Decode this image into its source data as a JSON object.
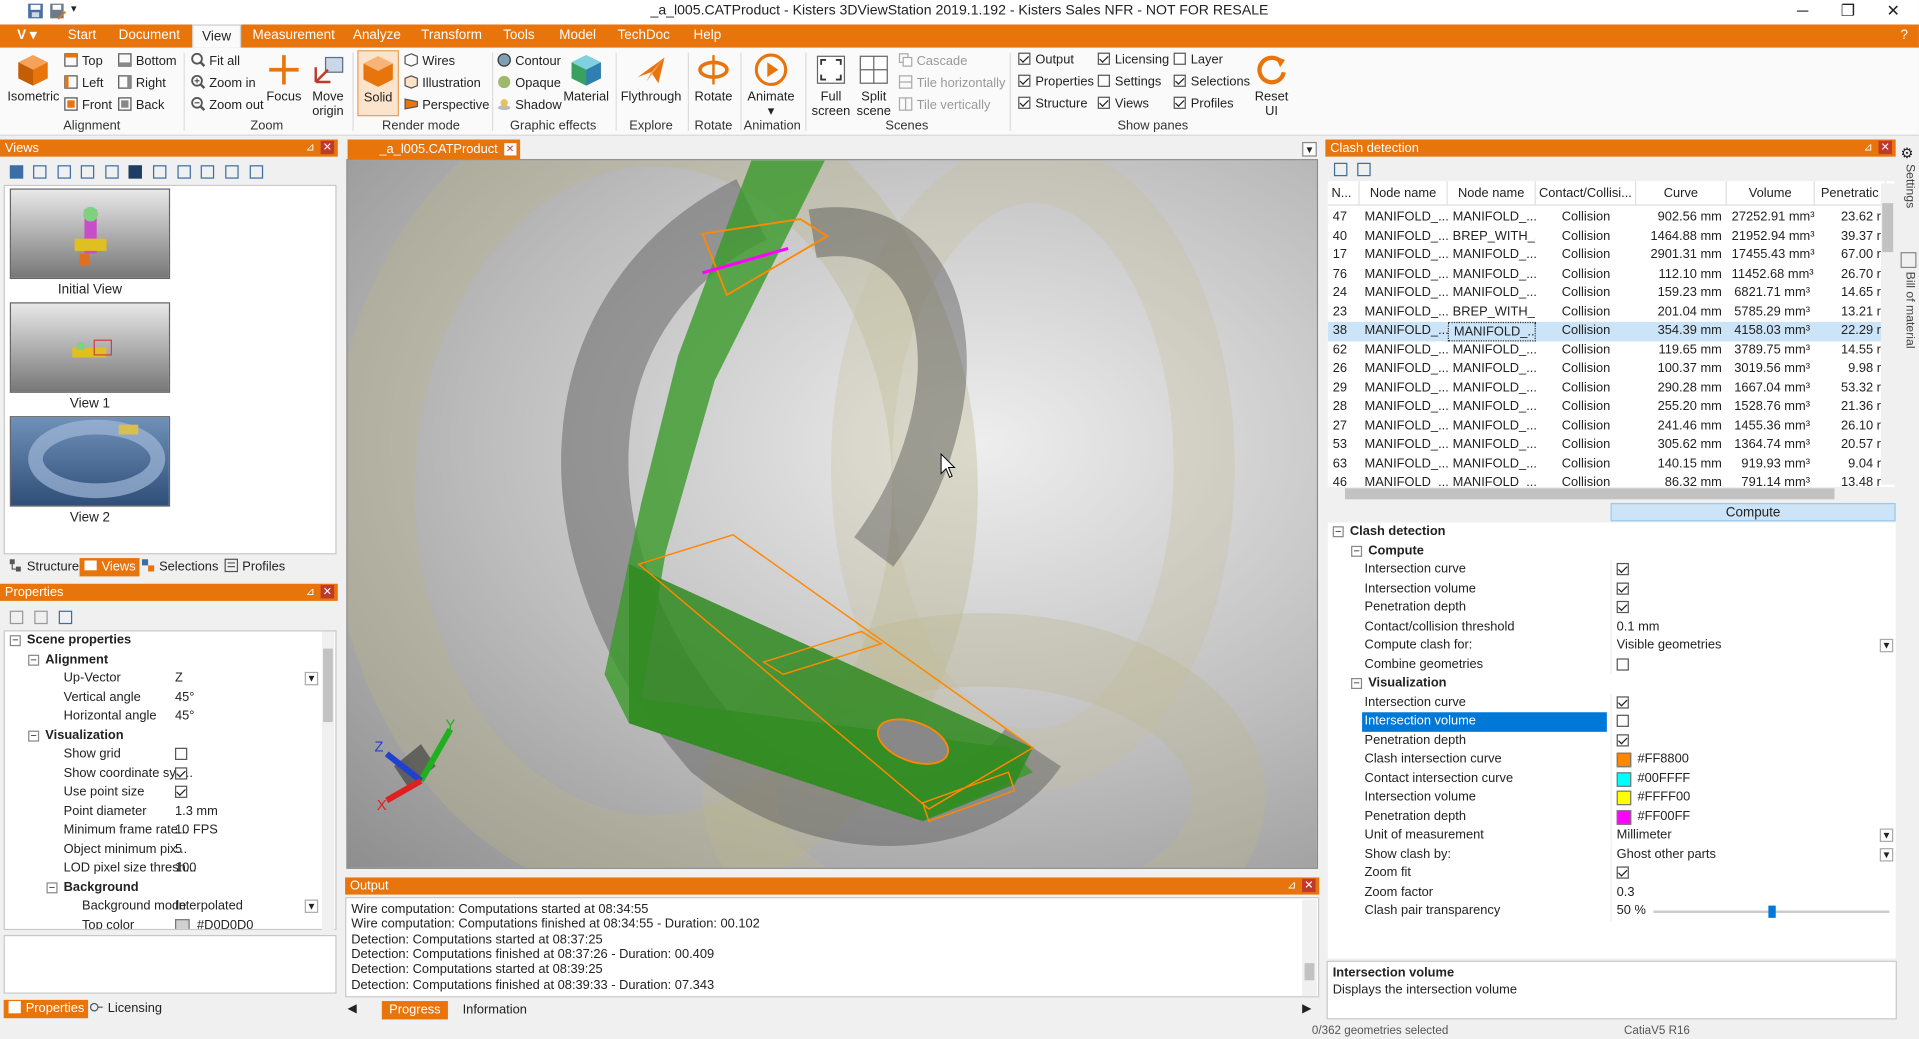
{
  "window": {
    "title": "_a_l005.CATProduct - Kisters 3DViewStation 2019.1.192 - Kisters Sales NFR - NOT FOR RESALE",
    "minimize": "─",
    "restore": "❐",
    "close": "✕"
  },
  "tabs": [
    "Start",
    "Document",
    "View",
    "Measurement",
    "Analyze",
    "Transform",
    "Tools",
    "Model",
    "TechDoc",
    "Help"
  ],
  "app_button": "V",
  "ribbon": {
    "iso": "Isometric",
    "top": "Top",
    "left": "Left",
    "front": "Front",
    "bottom": "Bottom",
    "right": "Right",
    "back": "Back",
    "fitall": "Fit all",
    "zoomin": "Zoom in",
    "zoomout": "Zoom out",
    "focus": "Focus",
    "moveorigin": "Move origin",
    "solid": "Solid",
    "wires": "Wires",
    "illustration": "Illustration",
    "perspective": "Perspective",
    "contour": "Contour",
    "opaque": "Opaque",
    "shadow": "Shadow",
    "material": "Material",
    "flythrough": "Flythrough",
    "rotate": "Rotate",
    "animate": "Animate",
    "fullscreen": "Full screen",
    "splitscene": "Split scene",
    "cascade": "Cascade",
    "tileh": "Tile horizontally",
    "tilev": "Tile vertically",
    "output": "Output",
    "properties": "Properties",
    "structure": "Structure",
    "licensing": "Licensing",
    "settings": "Settings",
    "views": "Views",
    "layer": "Layer",
    "selections": "Selections",
    "profiles": "Profiles",
    "resetui": "Reset UI",
    "groups": {
      "alignment": "Alignment",
      "zoom": "Zoom",
      "rendermode": "Render mode",
      "graphiceffects": "Graphic effects",
      "explore": "Explore",
      "rotate": "Rotate",
      "animation": "Animation",
      "scenes": "Scenes",
      "showpanes": "Show panes"
    }
  },
  "views_panel": {
    "title": "Views",
    "items": [
      "Initial View",
      "View 1",
      "View 2"
    ],
    "tabs": [
      "Structure",
      "Views",
      "Selections",
      "Profiles"
    ]
  },
  "properties_panel": {
    "title": "Properties",
    "tabs": [
      "Properties",
      "Licensing"
    ],
    "rows": [
      {
        "name": "Scene properties",
        "value": "",
        "lvl": 0,
        "sect": true
      },
      {
        "name": "Alignment",
        "value": "",
        "lvl": 1,
        "sect": true
      },
      {
        "name": "Up-Vector",
        "value": "Z",
        "lvl": 2
      },
      {
        "name": "Vertical angle",
        "value": "45°",
        "lvl": 2
      },
      {
        "name": "Horizontal angle",
        "value": "45°",
        "lvl": 2
      },
      {
        "name": "Visualization",
        "value": "",
        "lvl": 1,
        "sect": true
      },
      {
        "name": "Show grid",
        "value": "",
        "lvl": 2,
        "cb": false
      },
      {
        "name": "Show coordinate sys...",
        "value": "",
        "lvl": 2,
        "cb": true
      },
      {
        "name": "Use point size",
        "value": "",
        "lvl": 2,
        "cb": true
      },
      {
        "name": "Point diameter",
        "value": "1.3 mm",
        "lvl": 2
      },
      {
        "name": "Minimum frame rate...",
        "value": "10 FPS",
        "lvl": 2
      },
      {
        "name": "Object minimum pix...",
        "value": "5",
        "lvl": 2
      },
      {
        "name": "LOD pixel size thresh...",
        "value": "100",
        "lvl": 2
      },
      {
        "name": "Background",
        "value": "",
        "lvl": 2,
        "sect": true
      },
      {
        "name": "Background mode",
        "value": "Interpolated",
        "lvl": 3
      },
      {
        "name": "Top color",
        "value": "#D0D0D0",
        "lvl": 3
      }
    ]
  },
  "document_tab": "_a_l005.CATProduct",
  "output": {
    "title": "Output",
    "lines": [
      "Wire computation: Computations started at 08:34:55",
      "Wire computation: Computations finished at 08:34:55 - Duration: 00.102",
      "Detection: Computations started at 08:37:25",
      "Detection: Computations finished at 08:37:26 - Duration: 00.409",
      "Detection: Computations started at 08:39:25",
      "Detection: Computations finished at 08:39:33 - Duration: 07.343"
    ],
    "tabs": [
      "Progress",
      "Information"
    ]
  },
  "clash": {
    "title": "Clash detection",
    "headers": [
      "N...",
      "Node name",
      "Node name",
      "Contact/Collisi...",
      "Curve",
      "Volume",
      "Penetratic"
    ],
    "rows": [
      [
        "47",
        "MANIFOLD_...",
        "MANIFOLD_...",
        "Collision",
        "902.56 mm",
        "27252.91 mm³",
        "23.62 r"
      ],
      [
        "40",
        "MANIFOLD_...",
        "BREP_WITH_...",
        "Collision",
        "1464.88 mm",
        "21952.94 mm³",
        "39.37 r"
      ],
      [
        "17",
        "MANIFOLD_...",
        "MANIFOLD_...",
        "Collision",
        "2901.31 mm",
        "17455.43 mm³",
        "67.00 r"
      ],
      [
        "76",
        "MANIFOLD_...",
        "MANIFOLD_...",
        "Collision",
        "112.10 mm",
        "11452.68 mm³",
        "26.70 r"
      ],
      [
        "24",
        "MANIFOLD_...",
        "MANIFOLD_...",
        "Collision",
        "159.23 mm",
        "6821.71 mm³",
        "14.65 r"
      ],
      [
        "23",
        "MANIFOLD_...",
        "BREP_WITH_...",
        "Collision",
        "201.04 mm",
        "5785.29 mm³",
        "13.21 r"
      ],
      [
        "38",
        "MANIFOLD_...",
        "MANIFOLD_...",
        "Collision",
        "354.39 mm",
        "4158.03 mm³",
        "22.29 r"
      ],
      [
        "62",
        "MANIFOLD_...",
        "MANIFOLD_...",
        "Collision",
        "119.65 mm",
        "3789.75 mm³",
        "14.55 r"
      ],
      [
        "26",
        "MANIFOLD_...",
        "MANIFOLD_...",
        "Collision",
        "100.37 mm",
        "3019.56 mm³",
        "9.98 r"
      ],
      [
        "29",
        "MANIFOLD_...",
        "MANIFOLD_...",
        "Collision",
        "290.28 mm",
        "1667.04 mm³",
        "53.32 r"
      ],
      [
        "28",
        "MANIFOLD_...",
        "MANIFOLD_...",
        "Collision",
        "255.20 mm",
        "1528.76 mm³",
        "21.36 r"
      ],
      [
        "27",
        "MANIFOLD_...",
        "MANIFOLD_...",
        "Collision",
        "241.46 mm",
        "1455.36 mm³",
        "26.10 r"
      ],
      [
        "53",
        "MANIFOLD_...",
        "MANIFOLD_...",
        "Collision",
        "305.62 mm",
        "1364.74 mm³",
        "20.57 r"
      ],
      [
        "63",
        "MANIFOLD_...",
        "MANIFOLD_...",
        "Collision",
        "140.15 mm",
        "919.93 mm³",
        "9.04 r"
      ],
      [
        "46",
        "MANIFOLD_...",
        "MANIFOLD_...",
        "Collision",
        "86.32 mm",
        "791.14 mm³",
        "13.48 r"
      ]
    ],
    "selected_row": 6,
    "compute_button": "Compute",
    "props": [
      {
        "name": "Clash detection",
        "lvl": 0,
        "sect": true
      },
      {
        "name": "Compute",
        "lvl": 1,
        "sect": true
      },
      {
        "name": "Intersection curve",
        "lvl": 2,
        "cb": true
      },
      {
        "name": "Intersection volume",
        "lvl": 2,
        "cb": true
      },
      {
        "name": "Penetration depth",
        "lvl": 2,
        "cb": true
      },
      {
        "name": "Contact/collision threshold",
        "lvl": 2,
        "value": "0.1 mm"
      },
      {
        "name": "Compute clash for:",
        "lvl": 2,
        "value": "Visible geometries",
        "dd": true
      },
      {
        "name": "Combine geometries",
        "lvl": 2,
        "cb": false
      },
      {
        "name": "Visualization",
        "lvl": 1,
        "sect": true
      },
      {
        "name": "Intersection curve",
        "lvl": 2,
        "cb": true
      },
      {
        "name": "Intersection volume",
        "lvl": 2,
        "cb": false,
        "sel": true
      },
      {
        "name": "Penetration depth",
        "lvl": 2,
        "cb": true
      },
      {
        "name": "Clash intersection curve",
        "lvl": 2,
        "value": "#FF8800",
        "color": "#FF8800"
      },
      {
        "name": "Contact intersection curve",
        "lvl": 2,
        "value": "#00FFFF",
        "color": "#00FFFF"
      },
      {
        "name": "Intersection volume",
        "lvl": 2,
        "value": "#FFFF00",
        "color": "#FFFF00"
      },
      {
        "name": "Penetration depth",
        "lvl": 2,
        "value": "#FF00FF",
        "color": "#FF00FF"
      },
      {
        "name": "Unit of measurement",
        "lvl": 2,
        "value": "Millimeter",
        "dd": true
      },
      {
        "name": "Show clash by:",
        "lvl": 2,
        "value": "Ghost other parts",
        "dd": true
      },
      {
        "name": "Zoom fit",
        "lvl": 2,
        "cb": true
      },
      {
        "name": "Zoom factor",
        "lvl": 2,
        "value": "0.3"
      },
      {
        "name": "Clash pair transparency",
        "lvl": 2,
        "value": "50 %",
        "slider": 0.5
      }
    ],
    "desc_title": "Intersection volume",
    "desc_text": "Displays the intersection volume"
  },
  "side_tabs": [
    "Settings",
    "Bill of material"
  ],
  "status": {
    "left": "0/362 geometries selected",
    "right": "CatiaV5 R16"
  }
}
